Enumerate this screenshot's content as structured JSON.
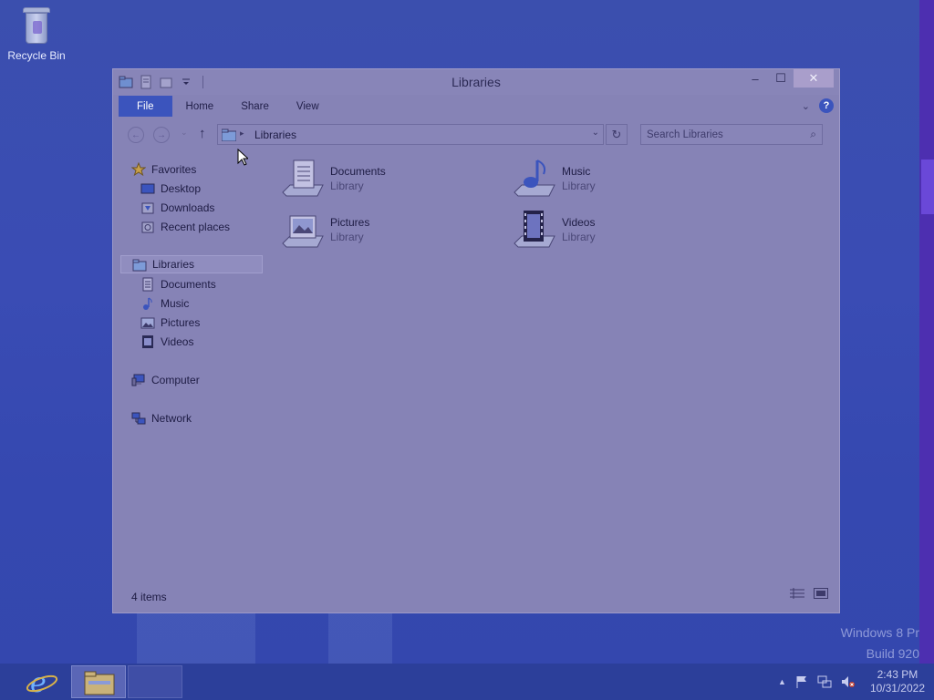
{
  "desktop": {
    "icons": [
      {
        "label": "Recycle Bin",
        "icon": "recycle-bin-icon"
      }
    ],
    "watermark": {
      "line1": "Windows 8 Pr",
      "line2": "Build 920"
    }
  },
  "window": {
    "title": "Libraries",
    "controls": {
      "minimize": "–",
      "maximize": "☐",
      "close": "✕"
    },
    "ribbon": {
      "tabs": [
        "File",
        "Home",
        "Share",
        "View"
      ],
      "expand_glyph": "⌄",
      "help_glyph": "?"
    },
    "address": {
      "back_glyph": "←",
      "forward_glyph": "→",
      "recent_glyph": "⌄",
      "up_glyph": "↑",
      "crumb_sep": "▸",
      "breadcrumb": "Libraries",
      "dropdown_glyph": "⌄",
      "refresh_glyph": "↻",
      "search_placeholder": "Search Libraries",
      "search_glyph": "⌕"
    },
    "nav_pane": {
      "favorites": {
        "label": "Favorites",
        "items": [
          "Desktop",
          "Downloads",
          "Recent places"
        ]
      },
      "libraries": {
        "label": "Libraries",
        "items": [
          "Documents",
          "Music",
          "Pictures",
          "Videos"
        ]
      },
      "computer": "Computer",
      "network": "Network"
    },
    "libraries": [
      {
        "name": "Documents",
        "type": "Library",
        "icon": "documents-library-icon"
      },
      {
        "name": "Music",
        "type": "Library",
        "icon": "music-library-icon"
      },
      {
        "name": "Pictures",
        "type": "Library",
        "icon": "pictures-library-icon"
      },
      {
        "name": "Videos",
        "type": "Library",
        "icon": "videos-library-icon"
      }
    ],
    "status": "4 items"
  },
  "taskbar": {
    "tray_arrow": "▲",
    "time": "2:43 PM",
    "date": "10/31/2022"
  },
  "colors": {
    "accent": "#3b54bd",
    "taskbar": "#2c3f9a",
    "window": "#8683b6"
  }
}
